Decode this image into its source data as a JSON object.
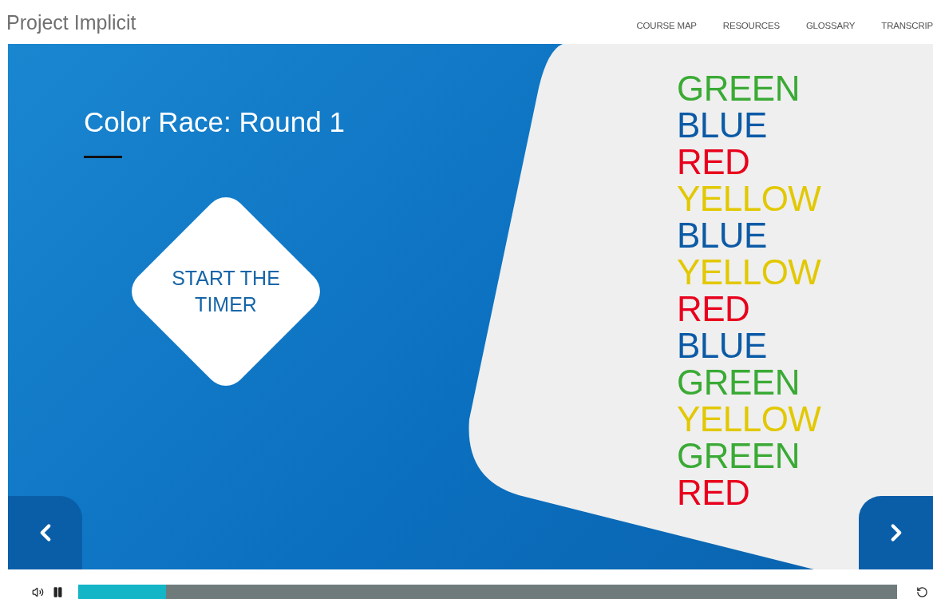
{
  "header": {
    "title": "Project Implicit",
    "nav": [
      {
        "label": "COURSE MAP"
      },
      {
        "label": "RESOURCES"
      },
      {
        "label": "GLOSSARY"
      },
      {
        "label": "TRANSCRIP"
      }
    ]
  },
  "slide": {
    "title": "Color Race: Round 1",
    "start_button": "START THE TIMER",
    "words": [
      {
        "text": "GREEN",
        "color": "#3aaa35"
      },
      {
        "text": "BLUE",
        "color": "#0b5aa6"
      },
      {
        "text": "RED",
        "color": "#e8001c"
      },
      {
        "text": "YELLOW",
        "color": "#e2c800"
      },
      {
        "text": "BLUE",
        "color": "#0b5aa6"
      },
      {
        "text": "YELLOW",
        "color": "#e2c800"
      },
      {
        "text": "RED",
        "color": "#e8001c"
      },
      {
        "text": "BLUE",
        "color": "#0b5aa6"
      },
      {
        "text": "GREEN",
        "color": "#3aaa35"
      },
      {
        "text": "YELLOW",
        "color": "#e2c800"
      },
      {
        "text": "GREEN",
        "color": "#3aaa35"
      },
      {
        "text": "RED",
        "color": "#e8001c"
      }
    ]
  },
  "player": {
    "progress": {
      "level": 0.107
    }
  }
}
